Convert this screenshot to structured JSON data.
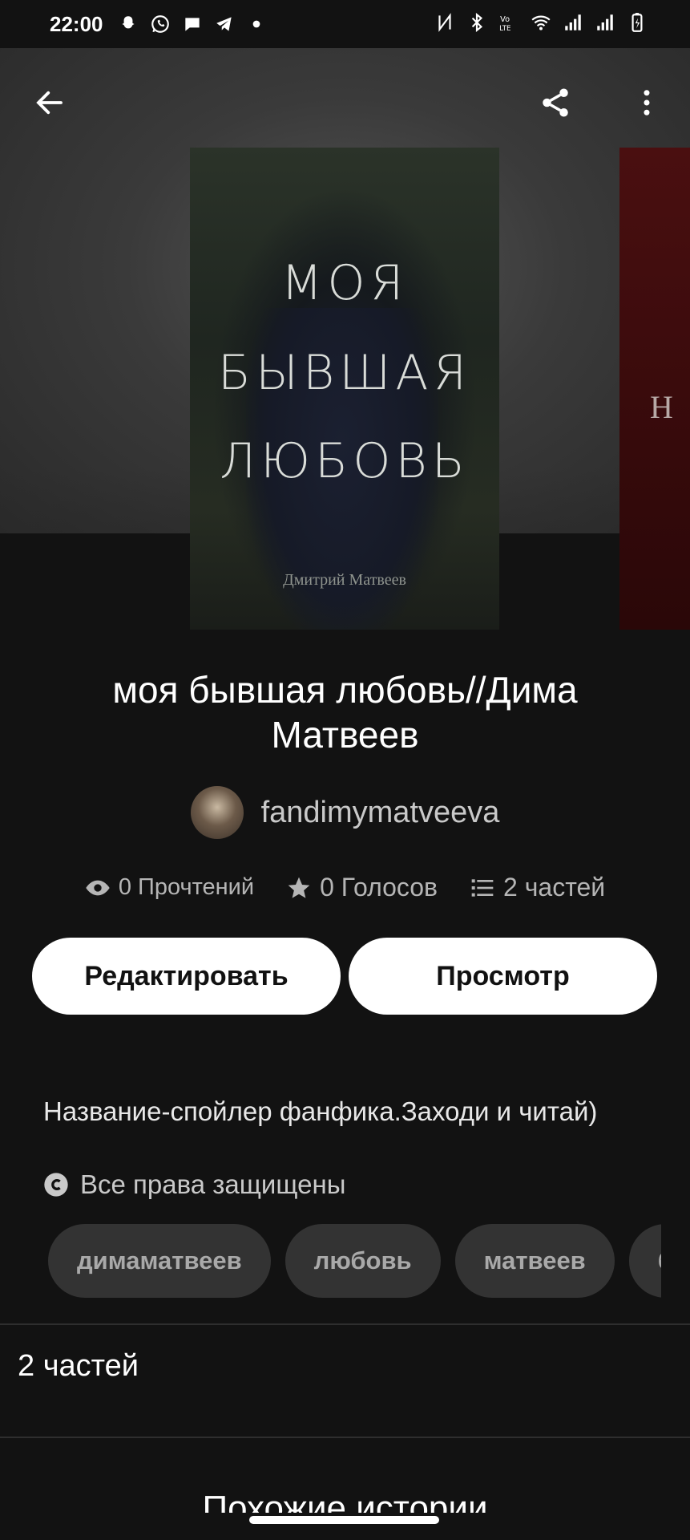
{
  "status_bar": {
    "time": "22:00",
    "left_icons": [
      "snapchat-icon",
      "whatsapp-icon",
      "chat-icon",
      "telegram-icon",
      "dot-icon"
    ],
    "right_icons": [
      "nfc-icon",
      "bluetooth-icon",
      "volte-icon",
      "wifi-icon",
      "signal-icon",
      "signal-icon",
      "battery-icon"
    ]
  },
  "toolbar": {
    "back_icon": "arrow-left-icon",
    "share_icon": "share-icon",
    "menu_icon": "more-vertical-icon"
  },
  "cover": {
    "title_lines": [
      "МОЯ",
      "БЫВШАЯ",
      "ЛЮБОВЬ"
    ],
    "author": "Дмитрий Матвеев"
  },
  "next_cover": {
    "text": "Н"
  },
  "story": {
    "title": "моя бывшая любовь//Дима Матвеев",
    "author": "fandimymatveeva",
    "stats": {
      "reads": "0 Прочтений",
      "votes": "0 Голосов",
      "parts": "2 частей"
    },
    "edit_button": "Редактировать",
    "view_button": "Просмотр",
    "description": "Название-спойлер фанфика.Заходи и читай)",
    "copyright": "Все права защищены",
    "tags": [
      "димаматвеев",
      "любовь",
      "матвеев",
      "б"
    ]
  },
  "sections": {
    "parts_heading": "2 частей",
    "similar_heading": "Похожие истории"
  }
}
